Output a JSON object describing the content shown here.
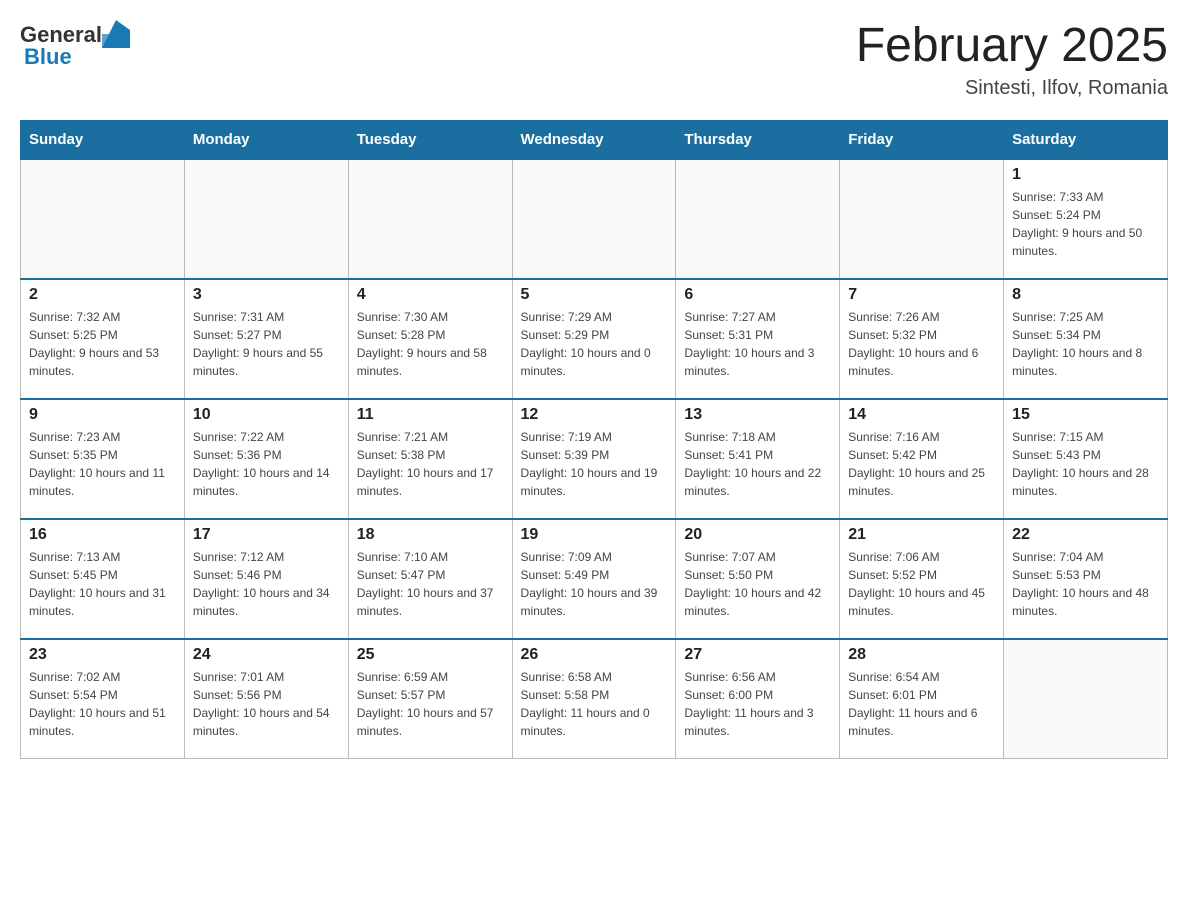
{
  "header": {
    "logo_general": "General",
    "logo_blue": "Blue",
    "month_title": "February 2025",
    "location": "Sintesti, Ilfov, Romania"
  },
  "weekdays": [
    "Sunday",
    "Monday",
    "Tuesday",
    "Wednesday",
    "Thursday",
    "Friday",
    "Saturday"
  ],
  "weeks": [
    [
      {
        "day": "",
        "info": ""
      },
      {
        "day": "",
        "info": ""
      },
      {
        "day": "",
        "info": ""
      },
      {
        "day": "",
        "info": ""
      },
      {
        "day": "",
        "info": ""
      },
      {
        "day": "",
        "info": ""
      },
      {
        "day": "1",
        "info": "Sunrise: 7:33 AM\nSunset: 5:24 PM\nDaylight: 9 hours and 50 minutes."
      }
    ],
    [
      {
        "day": "2",
        "info": "Sunrise: 7:32 AM\nSunset: 5:25 PM\nDaylight: 9 hours and 53 minutes."
      },
      {
        "day": "3",
        "info": "Sunrise: 7:31 AM\nSunset: 5:27 PM\nDaylight: 9 hours and 55 minutes."
      },
      {
        "day": "4",
        "info": "Sunrise: 7:30 AM\nSunset: 5:28 PM\nDaylight: 9 hours and 58 minutes."
      },
      {
        "day": "5",
        "info": "Sunrise: 7:29 AM\nSunset: 5:29 PM\nDaylight: 10 hours and 0 minutes."
      },
      {
        "day": "6",
        "info": "Sunrise: 7:27 AM\nSunset: 5:31 PM\nDaylight: 10 hours and 3 minutes."
      },
      {
        "day": "7",
        "info": "Sunrise: 7:26 AM\nSunset: 5:32 PM\nDaylight: 10 hours and 6 minutes."
      },
      {
        "day": "8",
        "info": "Sunrise: 7:25 AM\nSunset: 5:34 PM\nDaylight: 10 hours and 8 minutes."
      }
    ],
    [
      {
        "day": "9",
        "info": "Sunrise: 7:23 AM\nSunset: 5:35 PM\nDaylight: 10 hours and 11 minutes."
      },
      {
        "day": "10",
        "info": "Sunrise: 7:22 AM\nSunset: 5:36 PM\nDaylight: 10 hours and 14 minutes."
      },
      {
        "day": "11",
        "info": "Sunrise: 7:21 AM\nSunset: 5:38 PM\nDaylight: 10 hours and 17 minutes."
      },
      {
        "day": "12",
        "info": "Sunrise: 7:19 AM\nSunset: 5:39 PM\nDaylight: 10 hours and 19 minutes."
      },
      {
        "day": "13",
        "info": "Sunrise: 7:18 AM\nSunset: 5:41 PM\nDaylight: 10 hours and 22 minutes."
      },
      {
        "day": "14",
        "info": "Sunrise: 7:16 AM\nSunset: 5:42 PM\nDaylight: 10 hours and 25 minutes."
      },
      {
        "day": "15",
        "info": "Sunrise: 7:15 AM\nSunset: 5:43 PM\nDaylight: 10 hours and 28 minutes."
      }
    ],
    [
      {
        "day": "16",
        "info": "Sunrise: 7:13 AM\nSunset: 5:45 PM\nDaylight: 10 hours and 31 minutes."
      },
      {
        "day": "17",
        "info": "Sunrise: 7:12 AM\nSunset: 5:46 PM\nDaylight: 10 hours and 34 minutes."
      },
      {
        "day": "18",
        "info": "Sunrise: 7:10 AM\nSunset: 5:47 PM\nDaylight: 10 hours and 37 minutes."
      },
      {
        "day": "19",
        "info": "Sunrise: 7:09 AM\nSunset: 5:49 PM\nDaylight: 10 hours and 39 minutes."
      },
      {
        "day": "20",
        "info": "Sunrise: 7:07 AM\nSunset: 5:50 PM\nDaylight: 10 hours and 42 minutes."
      },
      {
        "day": "21",
        "info": "Sunrise: 7:06 AM\nSunset: 5:52 PM\nDaylight: 10 hours and 45 minutes."
      },
      {
        "day": "22",
        "info": "Sunrise: 7:04 AM\nSunset: 5:53 PM\nDaylight: 10 hours and 48 minutes."
      }
    ],
    [
      {
        "day": "23",
        "info": "Sunrise: 7:02 AM\nSunset: 5:54 PM\nDaylight: 10 hours and 51 minutes."
      },
      {
        "day": "24",
        "info": "Sunrise: 7:01 AM\nSunset: 5:56 PM\nDaylight: 10 hours and 54 minutes."
      },
      {
        "day": "25",
        "info": "Sunrise: 6:59 AM\nSunset: 5:57 PM\nDaylight: 10 hours and 57 minutes."
      },
      {
        "day": "26",
        "info": "Sunrise: 6:58 AM\nSunset: 5:58 PM\nDaylight: 11 hours and 0 minutes."
      },
      {
        "day": "27",
        "info": "Sunrise: 6:56 AM\nSunset: 6:00 PM\nDaylight: 11 hours and 3 minutes."
      },
      {
        "day": "28",
        "info": "Sunrise: 6:54 AM\nSunset: 6:01 PM\nDaylight: 11 hours and 6 minutes."
      },
      {
        "day": "",
        "info": ""
      }
    ]
  ]
}
